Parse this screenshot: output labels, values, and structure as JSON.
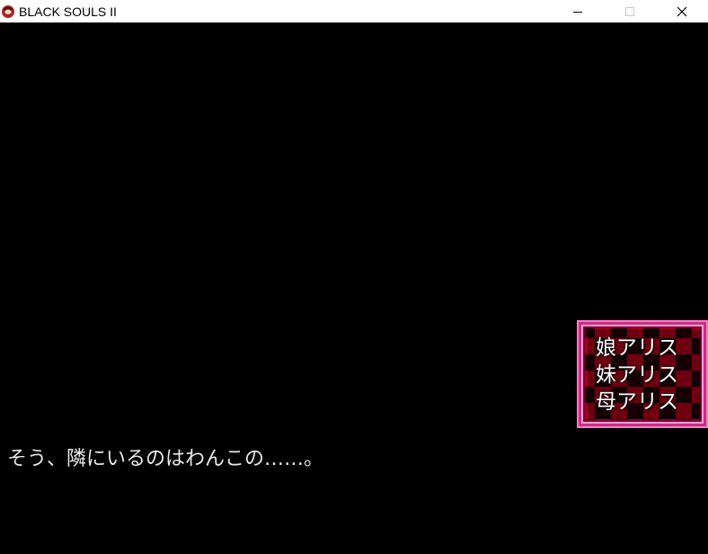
{
  "window": {
    "title": "BLACK SOULS  II",
    "icon": "game-app-icon",
    "controls": [
      "minimize-icon",
      "maximize-icon",
      "close-icon"
    ]
  },
  "choices": {
    "items": [
      "娘アリス",
      "妹アリス",
      "母アリス"
    ]
  },
  "dialogue": {
    "text": "そう、隣にいるのはわんこの……。"
  },
  "colors": {
    "background": "#000000",
    "window_pattern_dark": "#1c0004",
    "window_pattern_red": "#a5001a",
    "window_border": "#ff7ad0",
    "text": "#ffffff"
  }
}
